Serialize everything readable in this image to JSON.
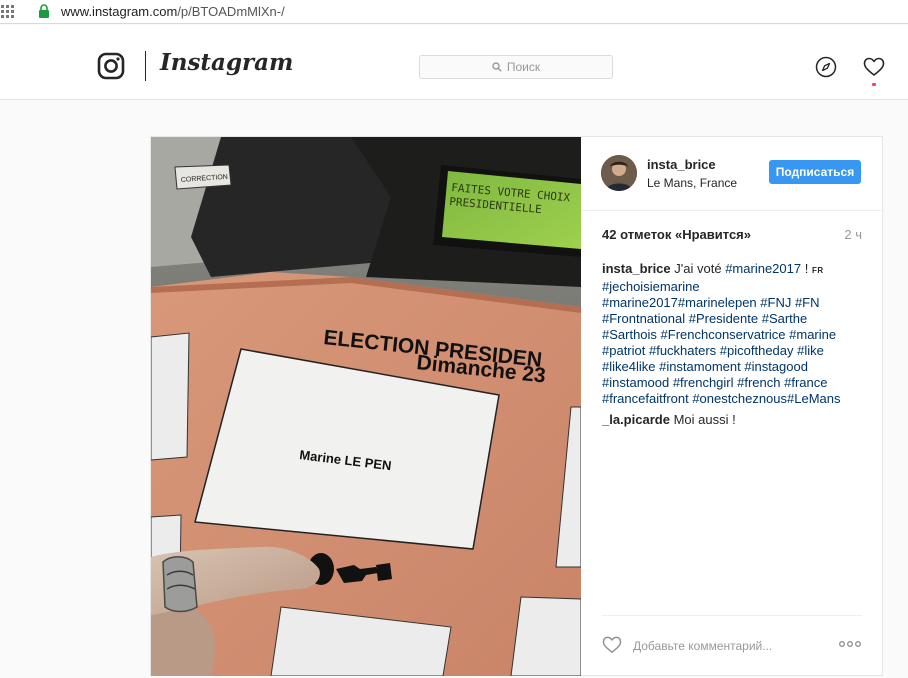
{
  "browser": {
    "url_host": "www.instagram.com",
    "url_path": "/p/BTOADmMlXn-/"
  },
  "header": {
    "wordmark": "Instagram",
    "search_placeholder": "Поиск",
    "icons": [
      "instagram-glyph-icon",
      "search-icon",
      "compass-icon",
      "heart-icon"
    ],
    "notification_color": "#ed4956"
  },
  "post": {
    "username": "insta_brice",
    "location": "Le Mans, France",
    "follow_label": "Подписаться",
    "likes": "42 отметок «Нравится»",
    "time": "2 ч",
    "caption": {
      "user": "insta_brice",
      "text_prefix": "J'ai voté",
      "lead_tag": "#marine2017",
      "excl": " !",
      "lang": "FR",
      "tags": [
        "#jechoisiemarine",
        "#marine2017#marinelepen #FNJ #FN",
        "#Frontnational #Presidente #Sarthe",
        "#Sarthois #Frenchconservatrice #marine",
        "#patriot #fuckhaters #picoftheday #like",
        "#like4like #instamoment #instagood",
        "#instamood #frenchgirl #french #france",
        "#francefaitfront #onestcheznous#LeMans"
      ]
    },
    "comment": {
      "user": "_la.picarde",
      "text": "Moi aussi !"
    },
    "add_comment_placeholder": "Добавьте комментарий...",
    "photo": {
      "screen_text": "FAITES VOTRE CHOIX\nPRESIDENTIELLE",
      "button_label": "CORRECTION",
      "panel_title_1": "ELECTION PRESIDEN",
      "panel_title_2": "Dimanche 23",
      "candidate": "Marine LE PEN"
    },
    "accent_color": "#3897f0"
  }
}
